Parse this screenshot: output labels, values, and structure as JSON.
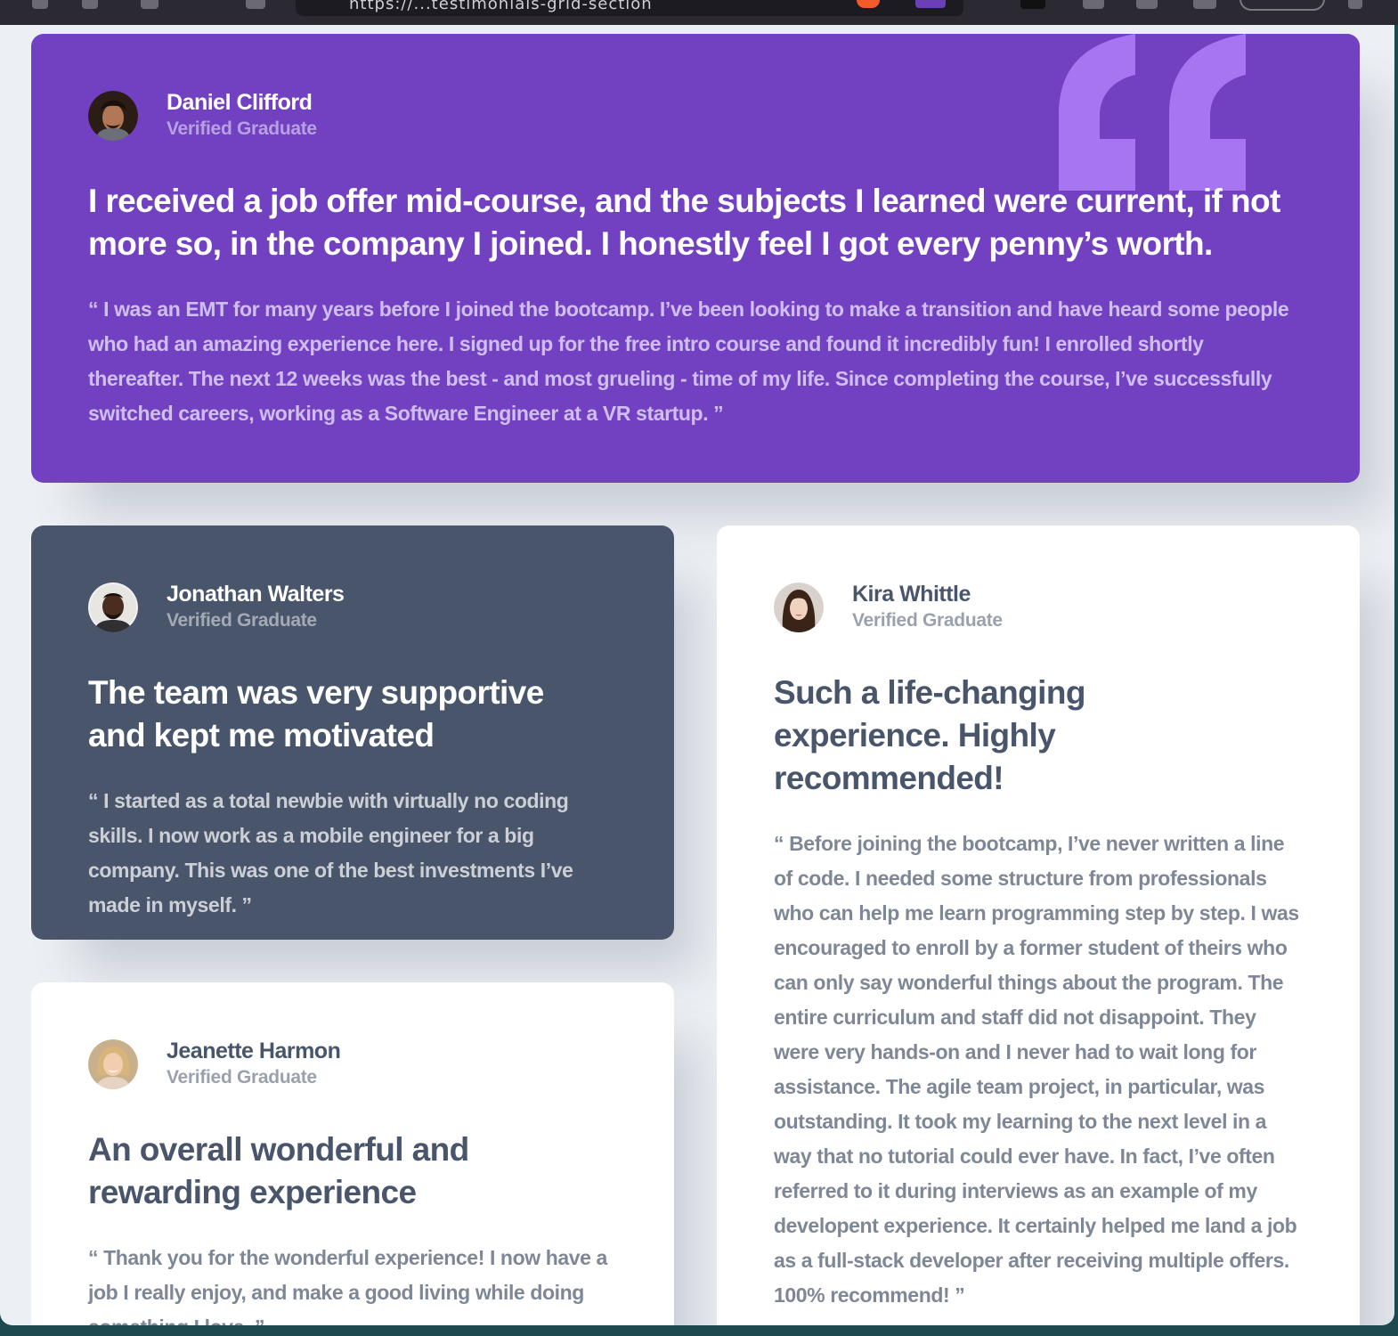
{
  "browser": {
    "url": "https://...testimonials-grid-section"
  },
  "testimonials": [
    {
      "name": "Daniel Clifford",
      "role": "Verified Graduate",
      "headline": "I received a job offer mid-course, and the subjects I learned were current, if not more so, in the company I joined. I honestly feel I got every penny’s worth.",
      "body": "“ I was an EMT for many years before I joined the bootcamp. I’ve been looking to make a transition and have heard some people who had an amazing experience here. I signed up for the free intro course and found it incredibly fun! I enrolled shortly thereafter. The next 12 weeks was the best - and most grueling - time of my life. Since completing the course, I’ve successfully switched careers, working as a Software Engineer at a VR startup. ”",
      "color": "#7141c1"
    },
    {
      "name": "Jonathan Walters",
      "role": "Verified Graduate",
      "headline": "The team was very supportive and kept me motivated",
      "body": "“ I started as a total newbie with virtually no coding skills. I now work as a mobile engineer for a big company. This was one of the best investments I’ve made in myself. ”",
      "color": "#48556a"
    },
    {
      "name": "Jeanette Harmon",
      "role": "Verified Graduate",
      "headline": "An overall wonderful and rewarding experience",
      "body": "“ Thank you for the wonderful experience! I now have a job I really enjoy, and make a good living while doing something I love. ”",
      "color": "#ffffff"
    },
    {
      "name": "Kira Whittle",
      "role": "Verified Graduate",
      "headline": "Such a life-changing experience. Highly recommended!",
      "body": "“ Before joining the bootcamp, I’ve never written a line of code. I needed some structure from professionals who can help me learn programming step by step. I was encouraged to enroll by a former student of theirs who can only say wonderful things about the program. The entire curriculum and staff did not disappoint. They were very hands-on and I never had to wait long for assistance. The agile team project, in particular, was outstanding. It took my learning to the next level in a way that no tutorial could ever have. In fact, I’ve often referred to it during interviews as an example of my developent experience. It certainly helped me land a job as a full-stack developer after receiving multiple offers. 100% recommend! ”",
      "color": "#ffffff"
    }
  ],
  "icons": {
    "quote": "quotation-mark-icon",
    "avatar": "avatar"
  }
}
